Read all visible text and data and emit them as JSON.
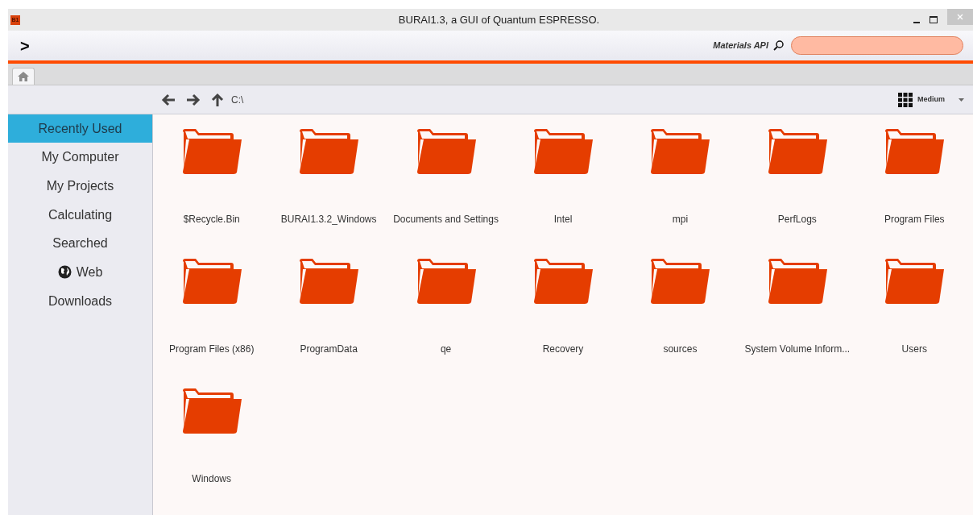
{
  "window": {
    "app_icon": "B1",
    "title": "BURAI1.3, a GUI of Quantum ESPRESSO."
  },
  "toolbar": {
    "expand": ">",
    "materials_api": "Materials API"
  },
  "tabs": [
    {
      "kind": "home",
      "selected": true
    }
  ],
  "nav": {
    "path": "C:\\",
    "view": "Medium"
  },
  "sidebar": {
    "items": [
      {
        "label": "Recently Used",
        "selected": true,
        "kind": "text"
      },
      {
        "label": "My Computer",
        "selected": false,
        "kind": "text"
      },
      {
        "label": "My Projects",
        "selected": false,
        "kind": "text"
      },
      {
        "label": "Calculating",
        "selected": false,
        "kind": "text"
      },
      {
        "label": "Searched",
        "selected": false,
        "kind": "text"
      },
      {
        "label": "Web",
        "selected": false,
        "kind": "globe"
      },
      {
        "label": "Downloads",
        "selected": false,
        "kind": "text"
      }
    ]
  },
  "folders": [
    "$Recycle.Bin",
    "BURAI1.3.2_Windows",
    "Documents and Settings",
    "Intel",
    "mpi",
    "PerfLogs",
    "Program Files",
    "Program Files (x86)",
    "ProgramData",
    "qe",
    "Recovery",
    "sources",
    "System Volume Inform...",
    "Users",
    "Windows"
  ]
}
